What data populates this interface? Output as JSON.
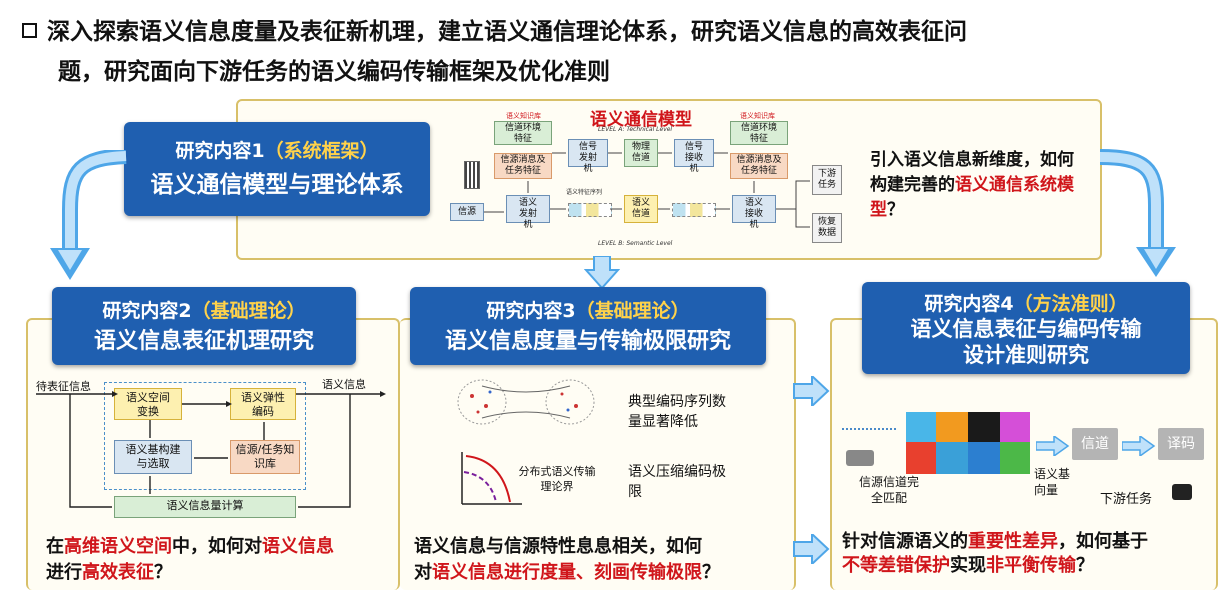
{
  "title": {
    "line1": "深入探索语义信息度量及表征新机理，建立语义通信理论体系，研究语义信息的高效表征问",
    "line2": "题，研究面向下游任务的语义编码传输框架及优化准则"
  },
  "content1": {
    "heading": "研究内容1",
    "tag": "（系统框架）",
    "subtitle": "语义通信模型与理论体系",
    "question_pre": "引入语义信息新维度，如何构建完善的",
    "question_red": "语义通信系统模型",
    "question_post": "？"
  },
  "model": {
    "title": "语义通信模型",
    "level_a": "LEVEL A: Technical Level",
    "level_b": "LEVEL B: Semantic Level",
    "kb_left": "语义知识库",
    "kb_right": "语义知识库",
    "channel_env_left": "信道环境特征",
    "source_msg_left": "信源消息及任务特征",
    "sig_tx": "信号发射机",
    "phys_ch": "物理信道",
    "sig_rx": "信号接收机",
    "channel_env_right": "信道环境特征",
    "source_msg_right": "信源消息及任务特征",
    "source": "信源",
    "sem_tx": "语义发射机",
    "feature_seq": "语义特征序列",
    "sem_ch": "语义信道",
    "sem_rx": "语义接收机",
    "downstream": "下游任务",
    "recover": "恢复数据"
  },
  "content2": {
    "heading": "研究内容2",
    "tag": "（基础理论）",
    "subtitle": "语义信息表征机理研究",
    "input_label": "待表征信息",
    "output_label": "语义信息",
    "sem_space": "语义空间变换",
    "elastic": "语义弹性编码",
    "sem_base": "语义基构建与选取",
    "kb": "信源/任务知识库",
    "calc": "语义信息量计算",
    "q_pre": "在",
    "q_red1": "高维语义空间",
    "q_mid": "中，如何对",
    "q_red2": "语义信息",
    "q_line2_pre": "进行",
    "q_red3": "高效表征",
    "q_post": "？"
  },
  "content3": {
    "heading": "研究内容3",
    "tag": "（基础理论）",
    "subtitle": "语义信息度量与传输极限研究",
    "fig_label": "分布式语义传输理论界",
    "point1": "典型编码序列数量显著降低",
    "point2": "语义压缩编码极限",
    "q_line1": "语义信息与信源特性息息相关，如何",
    "q_pre2": "对",
    "q_red": "语义信息进行度量、刻画传输极限",
    "q_post": "？"
  },
  "content4": {
    "heading": "研究内容4",
    "tag": "（方法准则）",
    "subtitle1": "语义信息表征与编码传输",
    "subtitle2": "设计准则研究",
    "match": "信源信道完全匹配",
    "basis": "语义基向量",
    "channel": "信道",
    "decode": "译码",
    "downstream": "下游任务",
    "q_pre": "针对信源语义的",
    "q_red1": "重要性差异",
    "q_mid": "，如何基于",
    "q_red2": "不等差错保护",
    "q_mid2": "实现",
    "q_red3": "非平衡传输",
    "q_post": "？"
  }
}
